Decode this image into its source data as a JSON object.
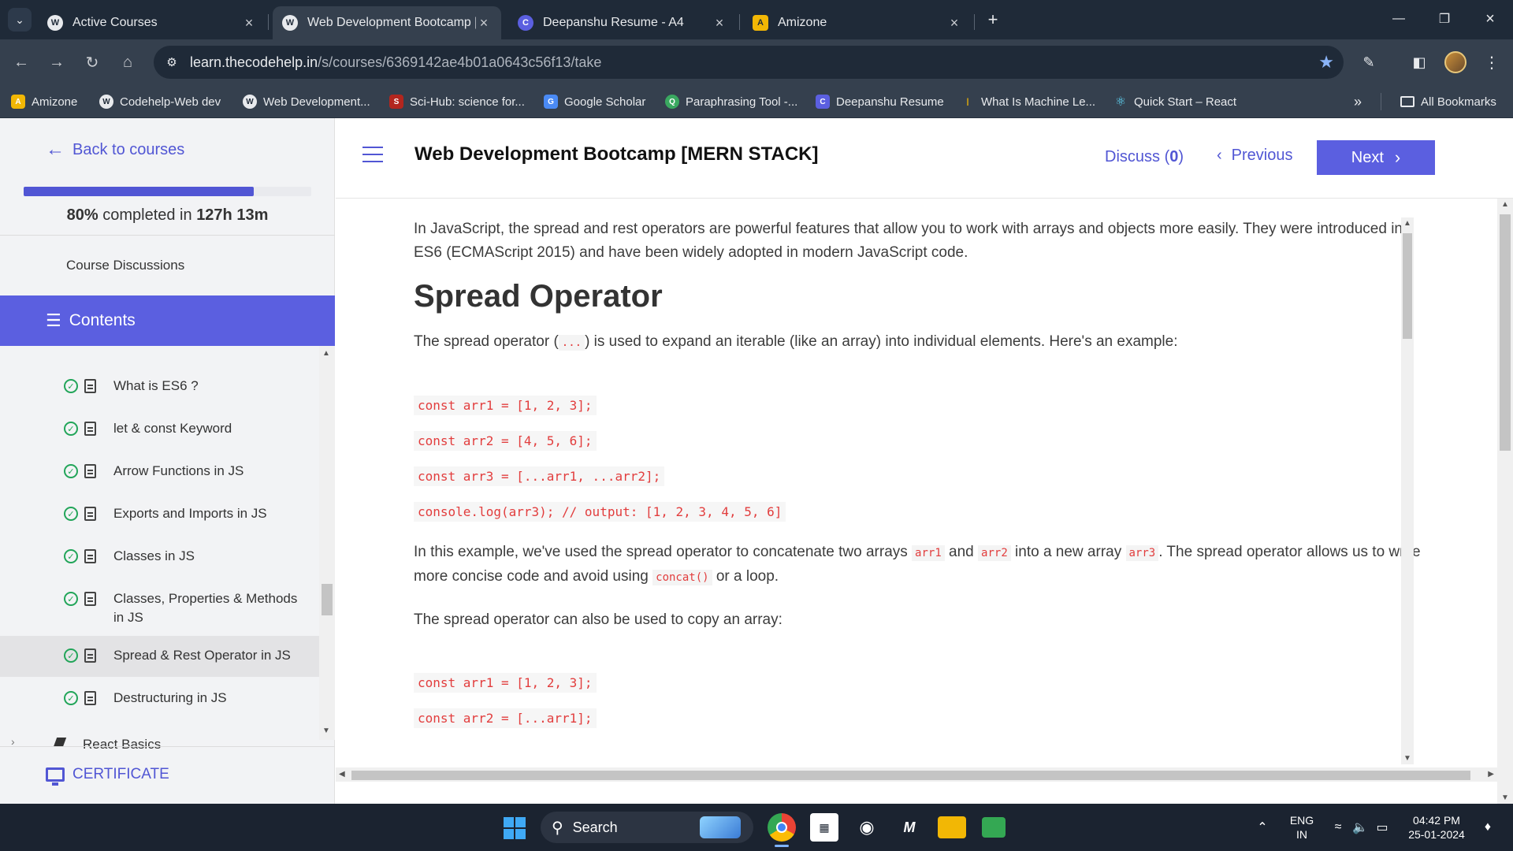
{
  "browser": {
    "tabs": [
      {
        "title": "Active Courses",
        "active": false
      },
      {
        "title": "Web Development Bootcamp [M",
        "active": true
      },
      {
        "title": "Deepanshu Resume - A4",
        "active": false
      },
      {
        "title": "Amizone",
        "active": false
      }
    ],
    "url_host": "learn.thecodehelp.in",
    "url_path": "/s/courses/6369142ae4b01a0643c56f13/take",
    "bookmarks": [
      "Amizone",
      "Codehelp-Web dev",
      "Web Development...",
      "Sci-Hub: science for...",
      "Google Scholar",
      "Paraphrasing Tool -...",
      "Deepanshu Resume",
      "What Is Machine Le...",
      "Quick Start – React"
    ],
    "all_bookmarks": "All Bookmarks"
  },
  "sidebar": {
    "back_label": "Back to courses",
    "progress_percent": 80,
    "progress_pct_text": "80%",
    "progress_mid": " completed in ",
    "progress_time": "127h 13m",
    "discussions_label": "Course Discussions",
    "contents_label": "Contents",
    "lessons": [
      {
        "title": "What is ES6 ?",
        "done": true
      },
      {
        "title": "let & const Keyword",
        "done": true
      },
      {
        "title": "Arrow Functions in JS",
        "done": true
      },
      {
        "title": "Exports and Imports in JS",
        "done": true
      },
      {
        "title": "Classes in JS",
        "done": true
      },
      {
        "title": "Classes, Properties & Methods in JS",
        "done": true
      },
      {
        "title": "Spread & Rest Operator in JS",
        "done": true,
        "current": true
      },
      {
        "title": "Destructuring in JS",
        "done": true
      }
    ],
    "next_section": "React Basics",
    "certificate_label": "CERTIFICATE"
  },
  "header": {
    "course_title": "Web Development Bootcamp [MERN STACK]",
    "discuss_label": "Discuss (",
    "discuss_count": "0",
    "discuss_close": ")",
    "previous_label": "Previous",
    "next_label": "Next"
  },
  "lesson": {
    "intro": "In JavaScript, the spread and rest operators are powerful features that allow you to work with arrays and objects more easily. They were introduced in ES6 (ECMAScript 2015) and have been widely adopted in modern JavaScript code.",
    "heading": "Spread Operator",
    "spread_p1_a": "The spread operator (",
    "spread_p1_code": "...",
    "spread_p1_b": ") is used to expand an iterable (like an array) into individual elements. Here's an example:",
    "code1": [
      "const arr1 = [1, 2, 3];",
      "const arr2 = [4, 5, 6];",
      "const arr3 = [...arr1, ...arr2];",
      "console.log(arr3); // output: [1, 2, 3, 4, 5, 6]"
    ],
    "p2_a": "In this example, we've used the spread operator to concatenate two arrays ",
    "p2_c1": "arr1",
    "p2_b": " and ",
    "p2_c2": "arr2",
    "p2_c": " into a new array ",
    "p2_c3": "arr3",
    "p2_d": ". The spread operator allows us to write more concise code and avoid using ",
    "p2_c4": "concat()",
    "p2_e": " or a loop.",
    "p3": "The spread operator can also be used to copy an array:",
    "code2": [
      "const arr1 = [1, 2, 3];",
      "const arr2 = [...arr1];"
    ]
  },
  "taskbar": {
    "search_label": "Search",
    "lang_top": "ENG",
    "lang_bottom": "IN",
    "time": "04:42 PM",
    "date": "25-01-2024"
  }
}
